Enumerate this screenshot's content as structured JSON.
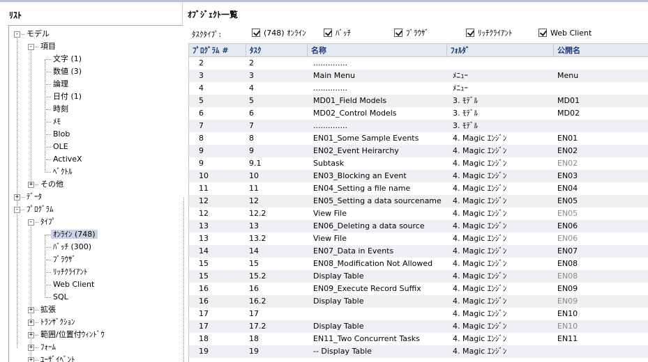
{
  "left": {
    "title": "ﾘｽﾄ",
    "tree": [
      {
        "label": "モデル",
        "level": 0,
        "exp": "-"
      },
      {
        "label": "項目",
        "level": 1,
        "exp": "-"
      },
      {
        "label": "文字 (1)",
        "level": 2,
        "exp": ""
      },
      {
        "label": "数値 (3)",
        "level": 2,
        "exp": ""
      },
      {
        "label": "論理",
        "level": 2,
        "exp": ""
      },
      {
        "label": "日付 (1)",
        "level": 2,
        "exp": ""
      },
      {
        "label": "時刻",
        "level": 2,
        "exp": ""
      },
      {
        "label": "ﾒﾓ",
        "level": 2,
        "exp": ""
      },
      {
        "label": "Blob",
        "level": 2,
        "exp": ""
      },
      {
        "label": "OLE",
        "level": 2,
        "exp": ""
      },
      {
        "label": "ActiveX",
        "level": 2,
        "exp": ""
      },
      {
        "label": "ﾍﾞｸﾄﾙ",
        "level": 2,
        "exp": ""
      },
      {
        "label": "その他",
        "level": 1,
        "exp": "+"
      },
      {
        "label": "ﾃﾞｰﾀ",
        "level": 0,
        "exp": "+"
      },
      {
        "label": "ﾌﾟﾛｸﾞﾗﾑ",
        "level": 0,
        "exp": "-"
      },
      {
        "label": "ﾀｲﾌﾟ",
        "level": 1,
        "exp": "-"
      },
      {
        "label": "ｵﾝﾗｲﾝ (748)",
        "level": 2,
        "exp": "",
        "selected": true
      },
      {
        "label": "ﾊﾞｯﾁ (300)",
        "level": 2,
        "exp": ""
      },
      {
        "label": "ﾌﾞﾗｳｻﾞ",
        "level": 2,
        "exp": ""
      },
      {
        "label": "ﾘｯﾁｸﾗｲｱﾝﾄ",
        "level": 2,
        "exp": ""
      },
      {
        "label": "Web Client",
        "level": 2,
        "exp": ""
      },
      {
        "label": "SQL",
        "level": 2,
        "exp": ""
      },
      {
        "label": "拡張",
        "level": 1,
        "exp": "+"
      },
      {
        "label": "ﾄﾗﾝｻﾞｸｼｮﾝ",
        "level": 1,
        "exp": "+"
      },
      {
        "label": "範囲/位置付ｳｨﾝﾄﾞｳ",
        "level": 1,
        "exp": "+"
      },
      {
        "label": "ﾌｫｰﾑ",
        "level": 1,
        "exp": "+"
      },
      {
        "label": "ﾕｰｻﾞｲﾍﾞﾝﾄ",
        "level": 1,
        "exp": "+"
      }
    ]
  },
  "right": {
    "title": "ｵﾌﾞｼﾞｪｸﾄ一覧",
    "task_type_label": "ﾀｽｸﾀｲﾌﾟ:",
    "filters": [
      {
        "label": "(748) ｵﾝﾗｲﾝ",
        "checked": true
      },
      {
        "label": "ﾊﾞｯﾁ",
        "checked": true
      },
      {
        "label": "ﾌﾞﾗｳｻﾞ",
        "checked": true
      },
      {
        "label": "ﾘｯﾁｸﾗｲｱﾝﾄ",
        "checked": true
      },
      {
        "label": "Web Client",
        "checked": true
      }
    ],
    "columns": [
      "ﾌﾟﾛｸﾞﾗﾑ #",
      "ﾀｽｸ",
      "名称",
      "ﾌｫﾙﾀﾞ",
      "公開名"
    ],
    "rows": [
      [
        "2",
        "2",
        "..............",
        "",
        ""
      ],
      [
        "3",
        "3",
        "Main Menu",
        "ﾒﾆｭｰ",
        "Menu"
      ],
      [
        "4",
        "4",
        "..............",
        "ﾒﾆｭｰ",
        ""
      ],
      [
        "5",
        "5",
        "MD01_Field Models",
        "3. ﾓﾃﾞﾙ",
        "MD01"
      ],
      [
        "6",
        "6",
        "MD02_Control Models",
        "3. ﾓﾃﾞﾙ",
        "MD02"
      ],
      [
        "7",
        "7",
        "..............",
        "3. ﾓﾃﾞﾙ",
        ""
      ],
      [
        "8",
        "8",
        "EN01_Some Sample Events",
        "4. Magic ｴﾝｼﾞﾝ",
        "EN01"
      ],
      [
        "9",
        "9",
        "EN02_Event Heirarchy",
        "4. Magic ｴﾝｼﾞﾝ",
        "EN02"
      ],
      [
        "9",
        "9.1",
        "Subtask",
        "4. Magic ｴﾝｼﾞﾝ",
        "EN02"
      ],
      [
        "10",
        "10",
        "EN03_Blocking an Event",
        "4. Magic ｴﾝｼﾞﾝ",
        "EN03"
      ],
      [
        "11",
        "11",
        "EN04_Setting a file name",
        "4. Magic ｴﾝｼﾞﾝ",
        "EN04"
      ],
      [
        "12",
        "12",
        "EN05_Setting a data sourcename",
        "4. Magic ｴﾝｼﾞﾝ",
        "EN05"
      ],
      [
        "12",
        "12.2",
        "View File",
        "4. Magic ｴﾝｼﾞﾝ",
        "EN05"
      ],
      [
        "13",
        "13",
        "EN06_Deleting a data source",
        "4. Magic ｴﾝｼﾞﾝ",
        "EN06"
      ],
      [
        "13",
        "13.2",
        "View File",
        "4. Magic ｴﾝｼﾞﾝ",
        "EN06"
      ],
      [
        "14",
        "14",
        "EN07_Data in Events",
        "4. Magic ｴﾝｼﾞﾝ",
        "EN07"
      ],
      [
        "15",
        "15",
        "EN08_Modification Not Allowed",
        "4. Magic ｴﾝｼﾞﾝ",
        "EN08"
      ],
      [
        "15",
        "15.2",
        "Display Table",
        "4. Magic ｴﾝｼﾞﾝ",
        "EN08"
      ],
      [
        "16",
        "16",
        "EN09_Execute Record Suffix",
        "4. Magic ｴﾝｼﾞﾝ",
        "EN09"
      ],
      [
        "16",
        "16.2",
        "Display Table",
        "4. Magic ｴﾝｼﾞﾝ",
        "EN09"
      ],
      [
        "17",
        "17",
        "",
        "4. Magic ｴﾝｼﾞﾝ",
        "EN10"
      ],
      [
        "17",
        "17.2",
        "Display Table",
        "4. Magic ｴﾝｼﾞﾝ",
        "EN10"
      ],
      [
        "18",
        "18",
        "EN11_Two Concurrent Tasks",
        "4. Magic ｴﾝｼﾞﾝ",
        "EN11"
      ],
      [
        "19",
        "19",
        "-- Display Table",
        "4. Magic ｴﾝｼﾞﾝ",
        ""
      ]
    ],
    "dim_public_rows": [
      8,
      12,
      14,
      17,
      19,
      21
    ]
  }
}
